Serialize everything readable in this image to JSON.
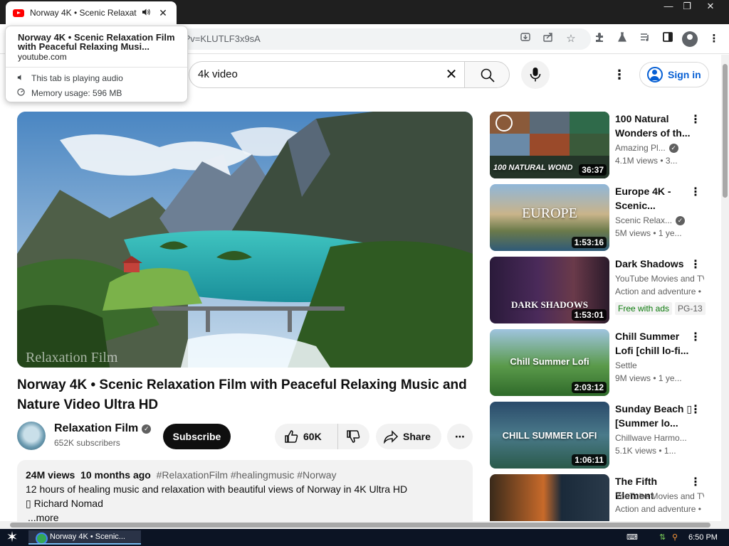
{
  "browser": {
    "tab_title": "Norway 4K • Scenic Relaxation",
    "tab_audio_icon": "speaker-icon",
    "tab_close": "✕",
    "url_fragment": "?v=KLUTLF3x9sA",
    "window_minimize": "—",
    "window_restore": "❐",
    "window_close": "✕"
  },
  "hovercard": {
    "title": "Norway 4K • Scenic Relaxation Film with Peaceful Relaxing Musi...",
    "domain": "youtube.com",
    "audio_status": "This tab is playing audio",
    "memory": "Memory usage: 596 MB"
  },
  "masthead": {
    "search_value": "4k video",
    "sign_in": "Sign in"
  },
  "video": {
    "title": "Norway 4K • Scenic Relaxation Film with Peaceful Relaxing Music and Nature Video Ultra HD",
    "watermark": "Relaxation Film"
  },
  "channel": {
    "name": "Relaxation Film",
    "subscribers": "652K subscribers",
    "subscribe_label": "Subscribe"
  },
  "actions": {
    "likes": "60K",
    "share": "Share"
  },
  "description": {
    "views": "24M views",
    "age": "10 months ago",
    "tags": "#RelaxationFilm #healingmusic #Norway",
    "line1": "12 hours of healing music and relaxation with beautiful views of Norway in 4K Ultra HD",
    "line2": "▯ Richard Nomad",
    "more": "...more"
  },
  "recommendations": [
    {
      "title": "100 Natural Wonders of th...",
      "channel": "Amazing Pl...",
      "verified": true,
      "meta": "4.1M views • 3...",
      "duration": "36:37",
      "thumb_text": "100 NATURAL WOND"
    },
    {
      "title": "Europe 4K - Scenic...",
      "channel": "Scenic Relax...",
      "verified": true,
      "meta": "5M views • 1 ye...",
      "duration": "1:53:16",
      "thumb_text": "EUROPE"
    },
    {
      "title": "Dark Shadows",
      "channel": "YouTube Movies and TV",
      "meta": "Action and adventure •",
      "duration": "1:53:01",
      "thumb_text": "DARK SHADOWS",
      "badge_free": "Free with ads",
      "badge_rating": "PG-13"
    },
    {
      "title": "Chill Summer Lofi [chill lo-fi...",
      "channel": "Settle",
      "meta": "9M views • 1 ye...",
      "duration": "2:03:12",
      "thumb_text": "Chill Summer Lofi"
    },
    {
      "title": "Sunday Beach ▯ [Summer lo...",
      "channel": "Chillwave Harmo...",
      "meta": "5.1K views • 1...",
      "duration": "1:06:11",
      "thumb_text": "CHILL SUMMER LOFI"
    },
    {
      "title": "The Fifth Element",
      "channel": "YouTube Movies and TV",
      "meta": "Action and adventure •",
      "duration": "",
      "thumb_text": ""
    }
  ],
  "taskbar": {
    "task_label": "Norway 4K • Scenic...",
    "time": "6:50 PM"
  }
}
